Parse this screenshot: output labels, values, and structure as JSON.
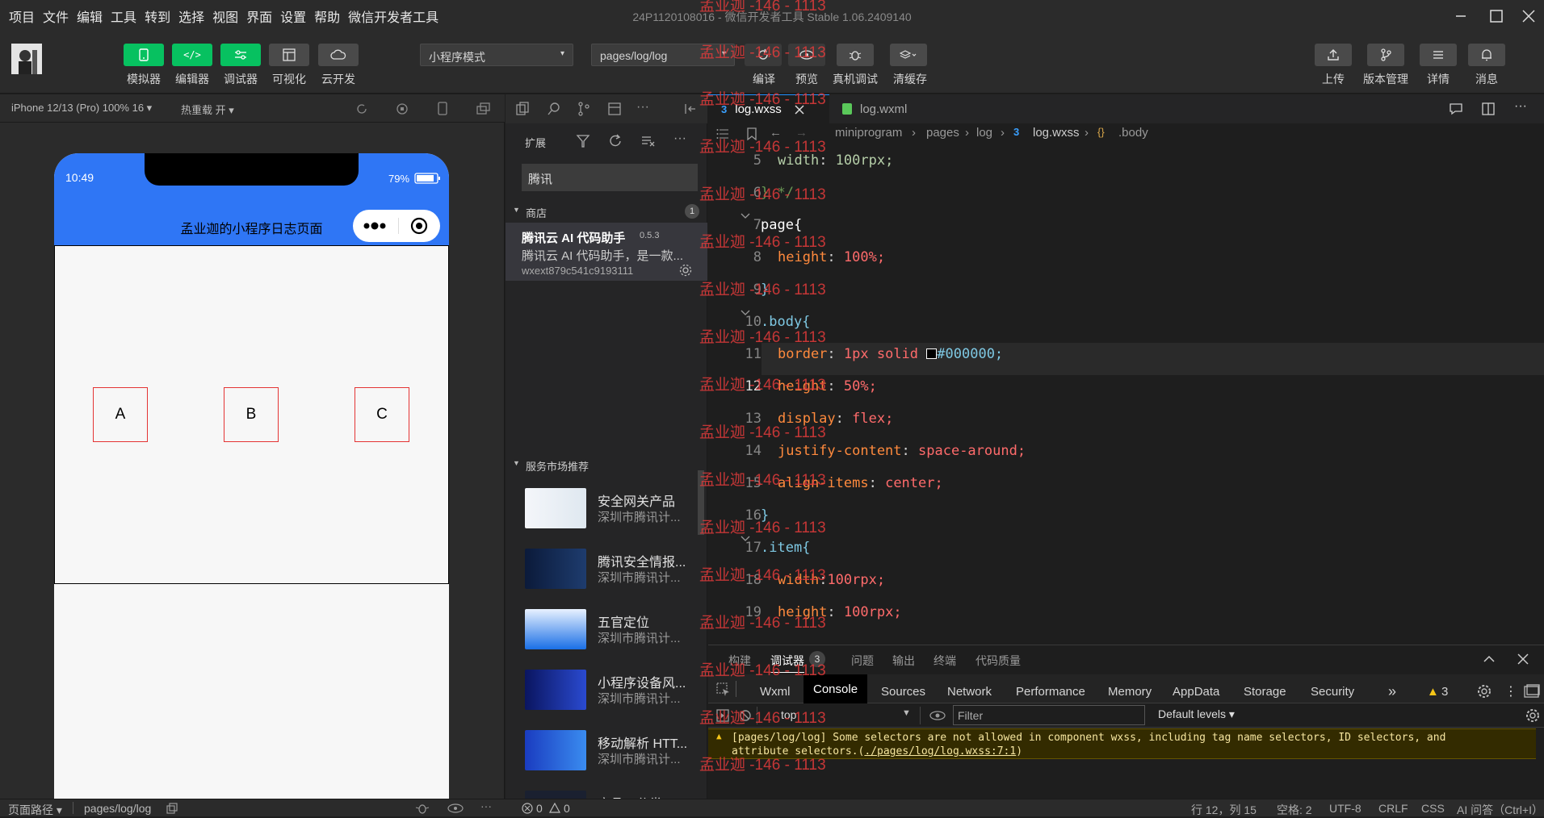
{
  "menubar": {
    "items": [
      "项目",
      "文件",
      "编辑",
      "工具",
      "转到",
      "选择",
      "视图",
      "界面",
      "设置",
      "帮助",
      "微信开发者工具"
    ],
    "title_project": "24P1120108016",
    "title_sep": " - ",
    "title_app": "微信开发者工具 Stable 1.06.2409140"
  },
  "toolbar": {
    "left_buttons": [
      "模拟器",
      "编辑器",
      "调试器",
      "可视化",
      "云开发"
    ],
    "mode_select": "小程序模式",
    "page_select": "pages/log/log",
    "mid_buttons": [
      "编译",
      "预览",
      "真机调试",
      "清缓存"
    ],
    "right_buttons": [
      "上传",
      "版本管理",
      "详情",
      "消息"
    ]
  },
  "simulator": {
    "device": "iPhone 12/13 (Pro) 100% 16 ▾",
    "hot_reload": "热重载 开 ▾",
    "time": "10:49",
    "battery": "79%",
    "nav_title": "孟业迦的小程序日志页面",
    "items": [
      "A",
      "B",
      "C"
    ]
  },
  "explorer": {
    "title": "扩展",
    "search_value": "腾讯",
    "store_section": "商店",
    "store_count": "1",
    "extension": {
      "name": "腾讯云 AI 代码助手",
      "version": "0.5.3",
      "desc": "腾讯云 AI 代码助手，是一款...",
      "id": "wxext879c541c9193111"
    },
    "market_section": "服务市场推荐",
    "services": [
      {
        "name": "安全网关产品",
        "company": "深圳市腾讯计..."
      },
      {
        "name": "腾讯安全情报...",
        "company": "深圳市腾讯计..."
      },
      {
        "name": "五官定位",
        "company": "深圳市腾讯计..."
      },
      {
        "name": "小程序设备风...",
        "company": "深圳市腾讯计..."
      },
      {
        "name": "移动解析 HTT...",
        "company": "深圳市腾讯计..."
      },
      {
        "name": "商品二分类",
        "company": ""
      }
    ]
  },
  "editor": {
    "tabs": [
      "log.wxss",
      "log.wxml"
    ],
    "breadcrumb": [
      "miniprogram",
      "pages",
      "log",
      "log.wxss",
      ".body"
    ],
    "lines": [
      {
        "n": "5",
        "p": "width",
        "v": "100rpx;"
      },
      {
        "n": "6",
        "t": "} */"
      },
      {
        "n": "7",
        "t": "page{"
      },
      {
        "n": "8",
        "p": "height",
        "v": "100%;"
      },
      {
        "n": "9",
        "t": "}"
      },
      {
        "n": "10",
        "t": ".body{"
      },
      {
        "n": "11",
        "p": "border",
        "v": "1px solid",
        "v2": "#000000;"
      },
      {
        "n": "12",
        "p": "height",
        "v": "50%;"
      },
      {
        "n": "13",
        "p": "display",
        "v": "flex;"
      },
      {
        "n": "14",
        "p": "justify-content",
        "v": "space-around;"
      },
      {
        "n": "15",
        "p": "align-items",
        "v": "center;"
      },
      {
        "n": "16",
        "t": "}"
      },
      {
        "n": "17",
        "t": ".item{"
      },
      {
        "n": "18",
        "p": "width",
        "v": "100rpx;"
      },
      {
        "n": "19",
        "p": "height",
        "v": "100rpx;"
      }
    ]
  },
  "panel": {
    "tabs": [
      "构建",
      "调试器",
      "问题",
      "输出",
      "终端",
      "代码质量"
    ],
    "debugger_badge": "3",
    "devtools_tabs": [
      "Wxml",
      "Console",
      "Sources",
      "Network",
      "Performance",
      "Memory",
      "AppData",
      "Storage",
      "Security"
    ],
    "warn_count": "3",
    "context": "top",
    "filter_placeholder": "Filter",
    "levels": "Default levels ▾",
    "warning_text": "[pages/log/log] Some selectors are not allowed in component wxss, including tag name selectors, ID selectors, and",
    "warning_text2": "attribute selectors.(",
    "warning_link": "./pages/log/log.wxss:7:1",
    "warning_end": ")"
  },
  "status": {
    "path_label": "页面路径 ▾",
    "path": "pages/log/log",
    "errors": "0",
    "warnings": "0",
    "cursor": "行 12，列 15",
    "spaces": "空格: 2",
    "encoding": "UTF-8",
    "eol": "CRLF",
    "lang": "CSS",
    "ai": "AI 问答（Ctrl+I）"
  },
  "watermark": "孟业迦 -146 - 1113"
}
